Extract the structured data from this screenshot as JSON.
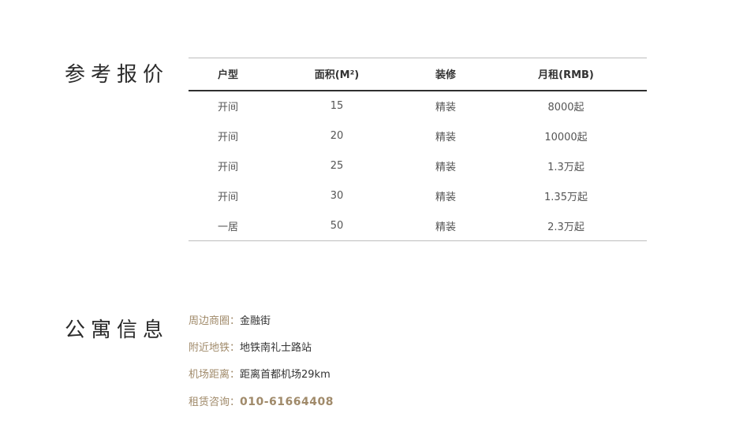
{
  "price_section": {
    "title": "参考报价",
    "headers": [
      "户型",
      "面积(M²)",
      "装修",
      "月租(RMB)"
    ],
    "rows": [
      [
        "开间",
        "15",
        "精装",
        "8000起"
      ],
      [
        "开间",
        "20",
        "精装",
        "10000起"
      ],
      [
        "开间",
        "25",
        "精装",
        "1.3万起"
      ],
      [
        "开间",
        "30",
        "精装",
        "1.35万起"
      ],
      [
        "一居",
        "50",
        "精装",
        "2.3万起"
      ]
    ]
  },
  "info_section": {
    "title": "公寓信息",
    "items": [
      {
        "label": "周边商圈：",
        "value": "金融街"
      },
      {
        "label": "附近地铁：",
        "value": "地铁南礼士路站"
      },
      {
        "label": "机场距离：",
        "value": "距离首都机场29km"
      },
      {
        "label": "租赁咨询：",
        "value": "010-61664408"
      }
    ]
  },
  "colors": {
    "accent": "#a08a6a",
    "text": "#333333",
    "rule_dark": "#2f2f2f",
    "rule_light": "#bdbdbd"
  }
}
